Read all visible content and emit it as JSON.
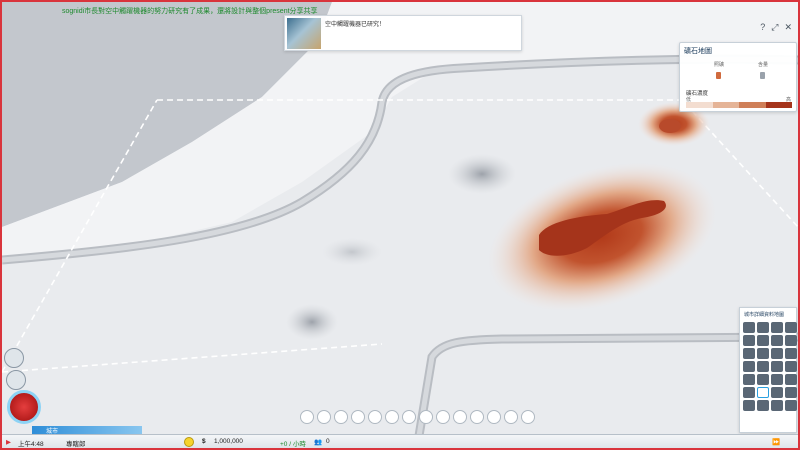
{
  "ticker": "sognidi市長對空中觸躍機器的努力研究有了成果，還將設計與整個present分享共享",
  "notification": {
    "text": "空中觸躍機器已研究！"
  },
  "top_icons": [
    "help-icon",
    "maximize-icon",
    "close-icon"
  ],
  "resource_panel": {
    "title": "礦石地圖",
    "col1": "照礦",
    "col2": "含量",
    "density_label": "礦石濃度",
    "low": "低",
    "high": "高",
    "colors": [
      "#f3ddd0",
      "#e5b497",
      "#cf7f58",
      "#a5341b"
    ]
  },
  "data_panel": {
    "title": "城市詳細資料地圖"
  },
  "city_tab": "城市",
  "status": {
    "time": "上午4:48",
    "mayor": "專瞎郎",
    "money": "1,000,000",
    "rate": "+0 / 小時",
    "population": "0"
  },
  "toolbar_icons": [
    "zone-icon",
    "road-icon",
    "power-icon",
    "water-icon",
    "sewage-icon",
    "government-icon",
    "garbage-icon",
    "health-icon",
    "fire-icon",
    "police-icon",
    "education-icon",
    "transport-icon",
    "park-icon",
    "specialization-icon"
  ]
}
